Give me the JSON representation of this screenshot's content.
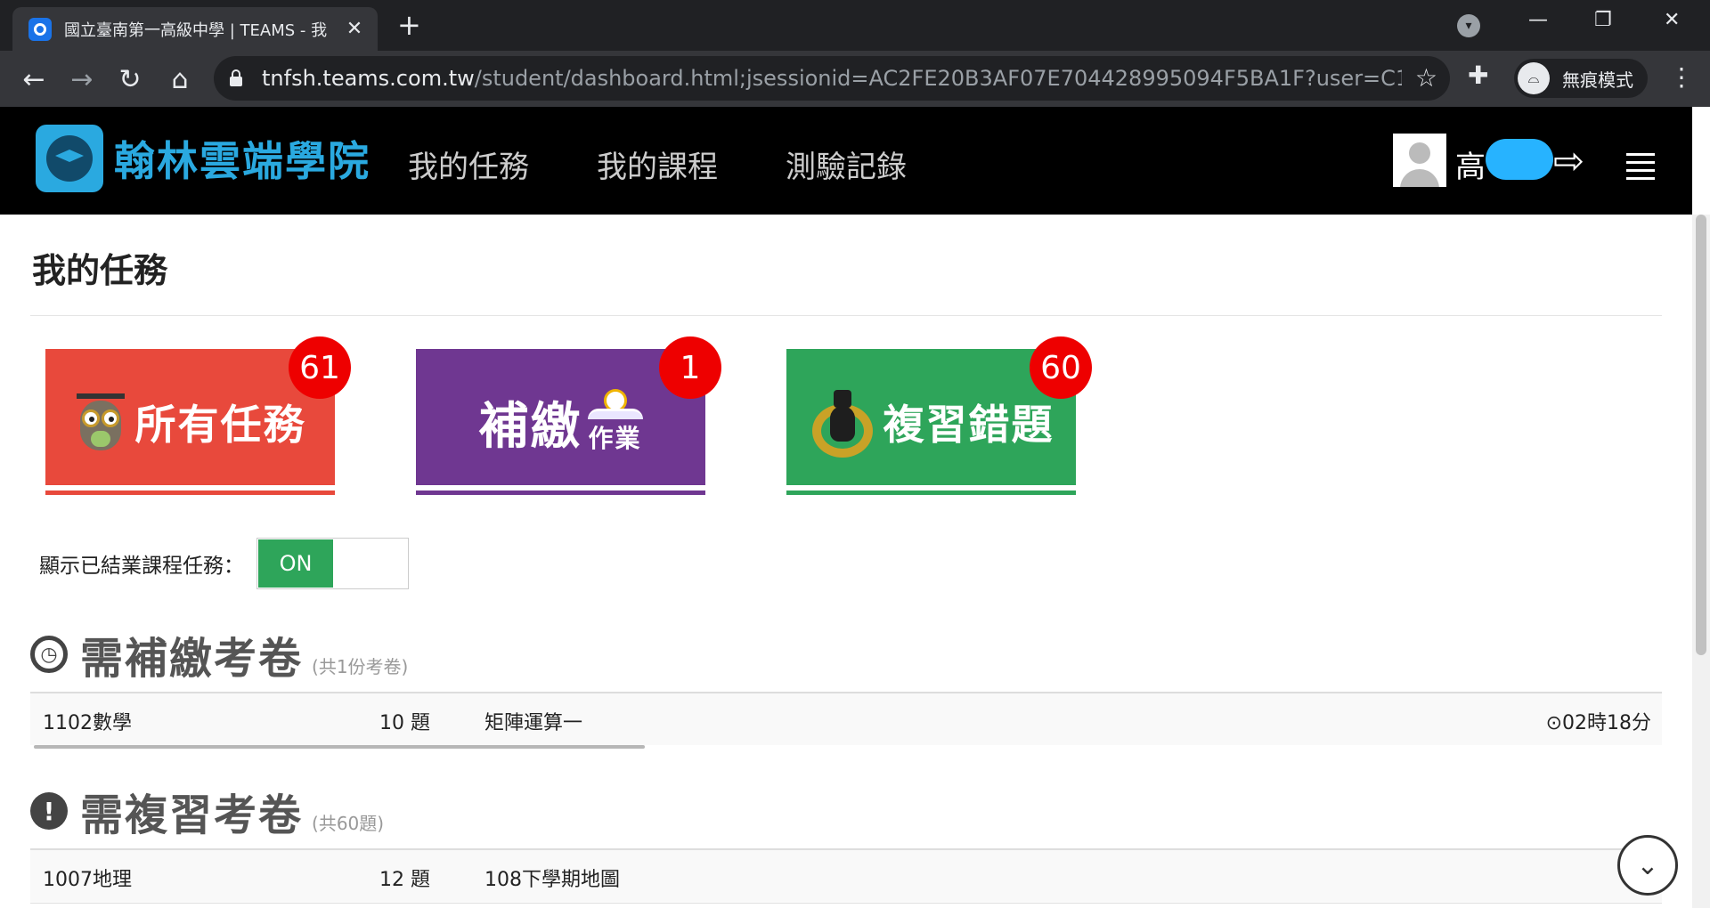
{
  "browser": {
    "tab_title": "國立臺南第一高級中學 | TEAMS - 我",
    "url_host": "tnfsh.teams.com.tw",
    "url_path": "/student/dashboard.html;jsessionid=AC2FE20B3AF07E704428995094F5BA1F?user=C1205...",
    "incognito_label": "無痕模式"
  },
  "site": {
    "logo_text": "翰林雲端學院",
    "nav": [
      "我的任務",
      "我的課程",
      "測驗記錄"
    ],
    "user_name": "高"
  },
  "page": {
    "title": "我的任務",
    "cards": [
      {
        "label": "所有任務",
        "badge": "61",
        "color": "#e8493c",
        "underline": "#e8493c"
      },
      {
        "label": "補繳",
        "sublabel": "作業",
        "badge": "1",
        "color": "#6f3791",
        "underline": "#6f3791"
      },
      {
        "label": "複習錯題",
        "badge": "60",
        "color": "#2ea55a",
        "underline": "#2ea55a"
      }
    ],
    "toggle": {
      "label": "顯示已結業課程任務：",
      "state": "ON"
    }
  },
  "sections": {
    "makeup": {
      "title": "需補繳考卷",
      "count": "(共1份考卷)",
      "rows": [
        {
          "course": "1102數學",
          "questions": "10 題",
          "name": "矩陣運算一",
          "time": "⊙02時18分"
        }
      ]
    },
    "review": {
      "title": "需複習考卷",
      "count": "(共60題)",
      "rows": [
        {
          "course": "1007地理",
          "questions": "12 題",
          "name": "108下學期地圖"
        }
      ]
    }
  }
}
